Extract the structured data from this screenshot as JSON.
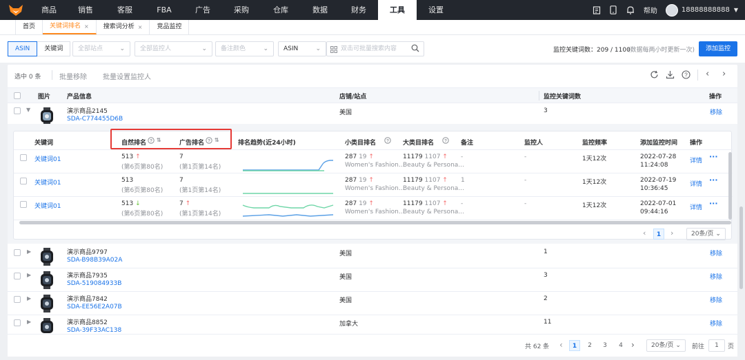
{
  "nav": {
    "items": [
      "商品",
      "销售",
      "客服",
      "FBA",
      "广告",
      "采购",
      "仓库",
      "数据",
      "财务",
      "工具",
      "设置"
    ],
    "active_index": 9,
    "help": "帮助",
    "phone": "18888888888"
  },
  "tabs": [
    {
      "label": "首页",
      "closable": false,
      "active": false
    },
    {
      "label": "关键词排名",
      "closable": true,
      "active": true
    },
    {
      "label": "搜索词分析",
      "closable": true,
      "active": false
    },
    {
      "label": "竞品监控",
      "closable": false,
      "active": false
    }
  ],
  "filters": {
    "seg_asin": "ASIN",
    "seg_keyword": "关键词",
    "site_placeholder": "全部站点",
    "monitor_placeholder": "全部监控人",
    "color_placeholder": "备注颜色",
    "search_type": "ASIN",
    "search_placeholder": "双击可批量搜索内容",
    "stat_label": "监控关键词数：209 / 1100",
    "stat_note": "(数据每两小时更新一次)",
    "add_button": "添加监控"
  },
  "toolbar": {
    "selected": "选中 0 条",
    "batch_remove": "批量移除",
    "batch_set": "批量设置监控人"
  },
  "table": {
    "headers": {
      "image": "图片",
      "product": "产品信息",
      "shop": "店铺/站点",
      "count": "监控关键词数",
      "action": "操作"
    },
    "rows": [
      {
        "name": "演示商品2145",
        "sku": "SDA-C774455D6B",
        "shop": "美国",
        "count": "3",
        "action": "移除"
      },
      {
        "name": "演示商品9797",
        "sku": "SDA-B98B39A02A",
        "shop": "美国",
        "count": "1",
        "action": "移除"
      },
      {
        "name": "演示商品7935",
        "sku": "SDA-519084933B",
        "shop": "美国",
        "count": "3",
        "action": "移除"
      },
      {
        "name": "演示商品7842",
        "sku": "SDA-EE56E2A07B",
        "shop": "美国",
        "count": "2",
        "action": "移除"
      },
      {
        "name": "演示商品8852",
        "sku": "SDA-39F33AC138",
        "shop": "加拿大",
        "count": "11",
        "action": "移除"
      }
    ]
  },
  "sub": {
    "headers": {
      "keyword": "关键词",
      "organic": "自然排名",
      "ad": "广告排名",
      "trend": "排名趋势(近24小时)",
      "small_cat": "小类目排名",
      "big_cat": "大类目排名",
      "note": "备注",
      "monitor": "监控人",
      "freq": "监控频率",
      "added": "添加监控时间",
      "action": "操作"
    },
    "rows": [
      {
        "keyword": "关键词01",
        "organic": "513",
        "organic_dir": "↑",
        "organic_sub": "(第6页第80名)",
        "ad": "7",
        "ad_dir": "",
        "ad_sub": "(第1页第14名)",
        "sc_a": "287",
        "sc_b": "19",
        "sc_dir": "↑",
        "sc_name": "Women's Fashion...",
        "bc_a": "11179",
        "bc_b": "1107",
        "bc_dir": "↑",
        "bc_name": "Beauty & Persona...",
        "note": "-",
        "monitor": "-",
        "freq": "1天12次",
        "date": "2022-07-28",
        "time": "11:24:08",
        "detail": "详情"
      },
      {
        "keyword": "关键词01",
        "organic": "513",
        "organic_dir": "",
        "organic_sub": "(第6页第80名)",
        "ad": "7",
        "ad_dir": "",
        "ad_sub": "(第1页第14名)",
        "sc_a": "287",
        "sc_b": "19",
        "sc_dir": "↑",
        "sc_name": "Women's Fashion...",
        "bc_a": "11179",
        "bc_b": "1107",
        "bc_dir": "↑",
        "bc_name": "Beauty & Persona...",
        "note": "1",
        "monitor": "-",
        "freq": "1天12次",
        "date": "2022-07-19",
        "time": "10:36:45",
        "detail": "详情"
      },
      {
        "keyword": "关键词01",
        "organic": "513",
        "organic_dir": "↓",
        "organic_sub": "(第6页第80名)",
        "ad": "7",
        "ad_dir": "↑",
        "ad_sub": "(第1页第14名)",
        "sc_a": "287",
        "sc_b": "19",
        "sc_dir": "↑",
        "sc_name": "Women's Fashion...",
        "bc_a": "11179",
        "bc_b": "1107",
        "bc_dir": "↑",
        "bc_name": "Beauty & Persona...",
        "note": "-",
        "monitor": "-",
        "freq": "1天12次",
        "date": "2022-07-01",
        "time": "09:44:16",
        "detail": "详情"
      }
    ],
    "pager_page": "1",
    "pager_size": "20条/页"
  },
  "pager": {
    "total": "共 62 条",
    "pages": [
      "1",
      "2",
      "3",
      "4"
    ],
    "current": "1",
    "size": "20条/页",
    "goto_label": "前往",
    "goto_value": "1",
    "goto_unit": "页"
  },
  "colors": {
    "primary": "#1a73e8",
    "accent": "#ff8a1f",
    "topbar": "#23272e",
    "highlight": "#e53935",
    "trend_blue": "#5aa0e6",
    "trend_green": "#6ed6a7"
  }
}
